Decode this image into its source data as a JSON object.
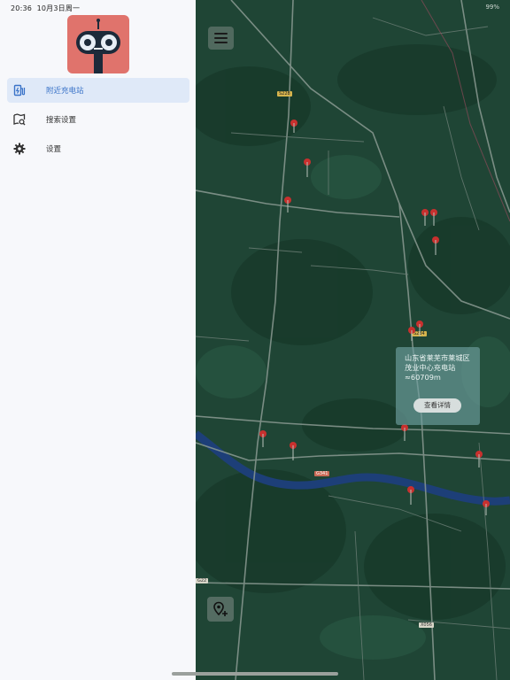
{
  "status_bar": {
    "time": "20:36",
    "date": "10月3日周一",
    "battery": "99%"
  },
  "drawer": {
    "items": [
      {
        "label": "附近充电站",
        "icon": "ev-charging-icon",
        "active": true
      },
      {
        "label": "搜索设置",
        "icon": "map-search-icon",
        "active": false
      },
      {
        "label": "设置",
        "icon": "gear-icon",
        "active": false
      }
    ]
  },
  "map": {
    "popup": {
      "name": "山东省莱芜市莱城区茂业中心充电站",
      "distance": "≈60709m",
      "button_label": "查看详情"
    },
    "road_labels": [
      "G341",
      "S228",
      "X056",
      "G22",
      "S234"
    ]
  },
  "colors": {
    "accent": "#3a73c8",
    "active_bg": "#dfe9f8",
    "pin": "#c8302e",
    "map_bg": "#1f4535",
    "river": "#1d3f78"
  }
}
